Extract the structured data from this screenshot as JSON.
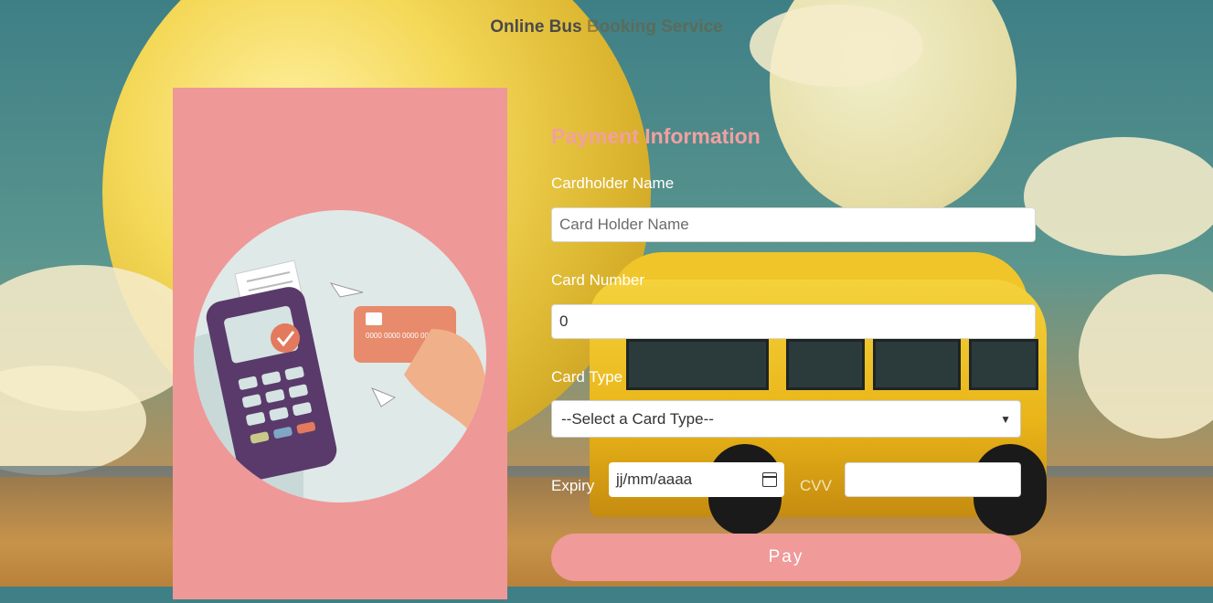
{
  "header": {
    "title_part1": "Online Bus ",
    "title_part2": "Booking Service"
  },
  "form": {
    "title": "Payment Information",
    "cardholder_label": "Cardholder Name",
    "cardholder_placeholder": "Card Holder Name",
    "card_number_label": "Card Number",
    "card_number_value": "0",
    "card_type_label": "Card Type",
    "card_type_selected": "--Select a Card Type--",
    "expiry_label": "Expiry",
    "expiry_placeholder": "jj/mm/aaaa",
    "cvv_label": "CVV",
    "pay_label": "Pay"
  },
  "illustration": {
    "card_number": "0000 0000 0000 0000",
    "terminal_icon": "checkmark-icon"
  },
  "colors": {
    "panel": "#ef9898",
    "title": "#f1a0a0",
    "pay_button": "#f09a9a"
  }
}
